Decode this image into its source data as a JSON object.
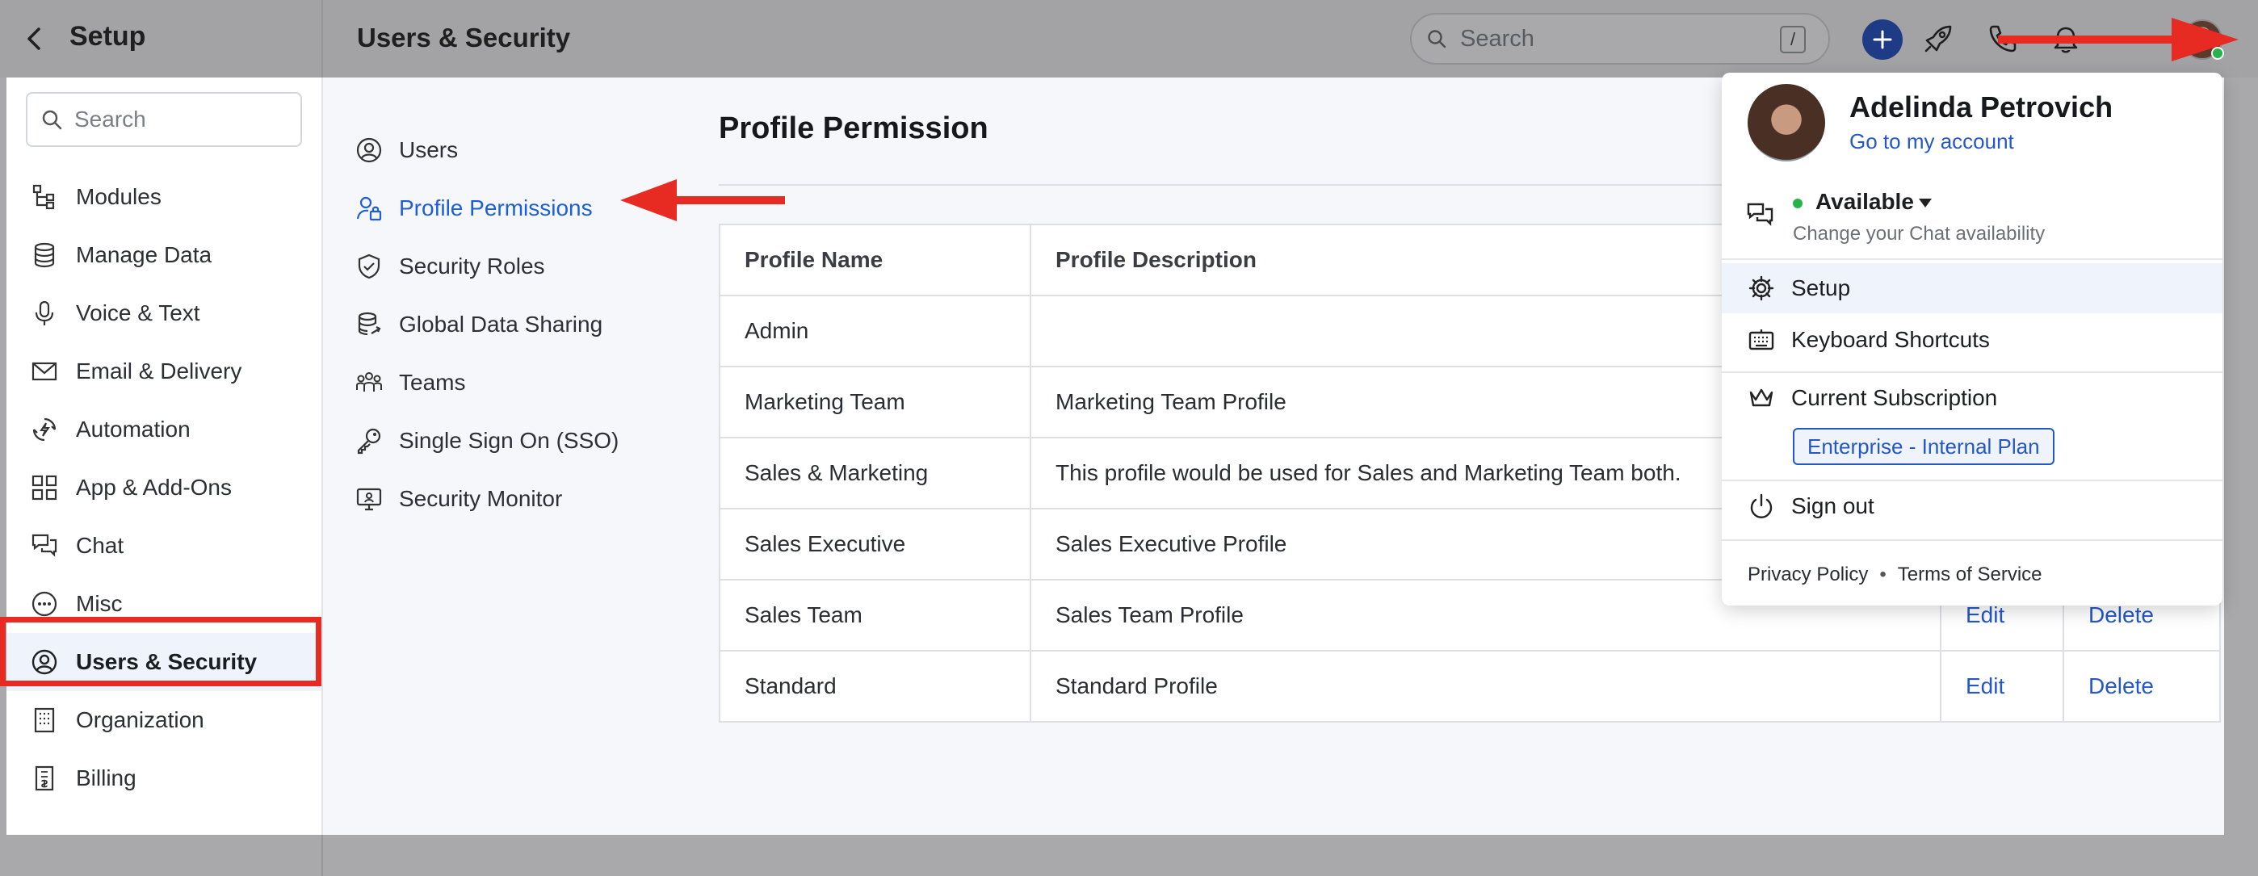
{
  "setup": {
    "back_label": "back",
    "title": "Setup"
  },
  "sidebar": {
    "search_placeholder": "Search",
    "items": [
      {
        "label": "Modules",
        "icon": "modules-icon"
      },
      {
        "label": "Manage Data",
        "icon": "database-icon"
      },
      {
        "label": "Voice & Text",
        "icon": "microphone-icon"
      },
      {
        "label": "Email & Delivery",
        "icon": "envelope-icon"
      },
      {
        "label": "Automation",
        "icon": "automation-icon"
      },
      {
        "label": "App & Add-Ons",
        "icon": "apps-grid-icon"
      },
      {
        "label": "Chat",
        "icon": "chat-icon"
      },
      {
        "label": "Misc",
        "icon": "more-circle-icon"
      },
      {
        "label": "Users & Security",
        "icon": "user-circle-icon",
        "active": true
      },
      {
        "label": "Organization",
        "icon": "building-icon"
      },
      {
        "label": "Billing",
        "icon": "receipt-icon"
      }
    ]
  },
  "header": {
    "title": "Users & Security",
    "search_placeholder": "Search",
    "search_shortcut": "/"
  },
  "subnav": {
    "items": [
      {
        "label": "Users",
        "icon": "user-circle-icon"
      },
      {
        "label": "Profile Permissions",
        "icon": "profile-lock-icon",
        "active": true
      },
      {
        "label": "Security Roles",
        "icon": "shield-check-icon"
      },
      {
        "label": "Global Data Sharing",
        "icon": "database-share-icon"
      },
      {
        "label": "Teams",
        "icon": "team-icon"
      },
      {
        "label": "Single Sign On (SSO)",
        "icon": "key-icon"
      },
      {
        "label": "Security Monitor",
        "icon": "monitor-icon"
      }
    ]
  },
  "main": {
    "title": "Profile Permission",
    "table": {
      "headers": [
        "Profile Name",
        "Profile Description"
      ],
      "rows": [
        {
          "name": "Admin",
          "description": "",
          "edit": "",
          "delete": ""
        },
        {
          "name": "Marketing Team",
          "description": "Marketing Team Profile",
          "edit": "",
          "delete": ""
        },
        {
          "name": "Sales & Marketing",
          "description": "This profile would be used for Sales and Marketing Team both.",
          "edit": "",
          "delete": ""
        },
        {
          "name": "Sales Executive",
          "description": "Sales Executive Profile",
          "edit": "",
          "delete": ""
        },
        {
          "name": "Sales Team",
          "description": "Sales Team Profile",
          "edit": "Edit",
          "delete": "Delete"
        },
        {
          "name": "Standard",
          "description": "Standard Profile",
          "edit": "Edit",
          "delete": "Delete"
        }
      ]
    }
  },
  "dropdown": {
    "name": "Adelinda Petrovich",
    "account_link": "Go to my account",
    "status": "Available",
    "status_hint": "Change your Chat availability",
    "setup": "Setup",
    "shortcuts": "Keyboard Shortcuts",
    "subscription": "Current Subscription",
    "plan": "Enterprise - Internal Plan",
    "sign_out": "Sign out",
    "privacy": "Privacy Policy",
    "separator": "•",
    "terms": "Terms of Service"
  },
  "colors": {
    "accent": "#2558c4",
    "annotation": "#e72a22",
    "online": "#27b24a",
    "primary_button": "#1e3b86"
  }
}
